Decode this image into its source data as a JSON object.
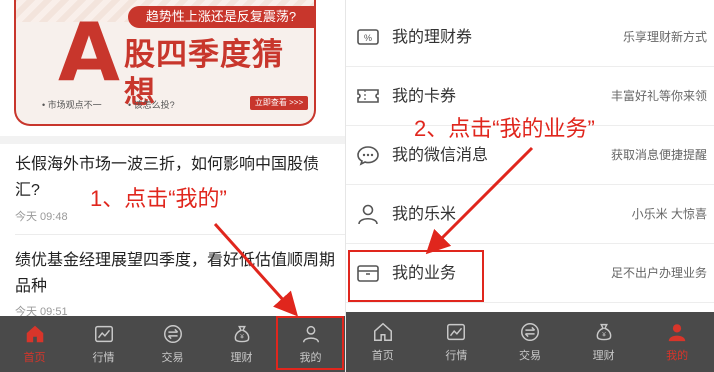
{
  "left": {
    "banner": {
      "top_text": "趋势性上涨还是反复震荡?",
      "big_letter": "A",
      "title": "股四季度猜想",
      "bullet1": "• 市场观点不一",
      "bullet2": "• 该怎么投?",
      "cta": "立即查看 >>>"
    },
    "news": [
      {
        "title": "长假海外市场一波三折，如何影响中国股债汇?",
        "time": "今天 09:48"
      },
      {
        "title": "绩优基金经理展望四季度，看好低估值顺周期品种",
        "time": "今天 09:51"
      }
    ],
    "annotation": "1、点击“我的”",
    "tabs": [
      {
        "label": "首页",
        "icon": "home-icon",
        "active": true
      },
      {
        "label": "行情",
        "icon": "chart-icon",
        "active": false
      },
      {
        "label": "交易",
        "icon": "exchange-icon",
        "active": false
      },
      {
        "label": "理财",
        "icon": "money-bag-icon",
        "active": false
      },
      {
        "label": "我的",
        "icon": "user-icon",
        "active": false
      }
    ]
  },
  "right": {
    "menu": [
      {
        "label": "我的理财券",
        "desc": "乐享理财新方式",
        "icon": "coupon-icon"
      },
      {
        "label": "我的卡券",
        "desc": "丰富好礼等你来领",
        "icon": "ticket-icon"
      },
      {
        "label": "我的微信消息",
        "desc": "获取消息便捷提醒",
        "icon": "wechat-icon"
      },
      {
        "label": "我的乐米",
        "desc": "小乐米 大惊喜",
        "icon": "person-icon"
      },
      {
        "label": "我的业务",
        "desc": "足不出户办理业务",
        "icon": "briefcase-icon"
      }
    ],
    "annotation": "2、点击“我的业务”",
    "tabs": [
      {
        "label": "首页",
        "icon": "home-icon",
        "active": false
      },
      {
        "label": "行情",
        "icon": "chart-icon",
        "active": false
      },
      {
        "label": "交易",
        "icon": "exchange-icon",
        "active": false
      },
      {
        "label": "理财",
        "icon": "money-bag-icon",
        "active": false
      },
      {
        "label": "我的",
        "icon": "user-icon",
        "active": true
      }
    ]
  },
  "colors": {
    "accent": "#e0261d",
    "tabbar": "#4a4a4a",
    "brand_red": "#c8362c"
  }
}
